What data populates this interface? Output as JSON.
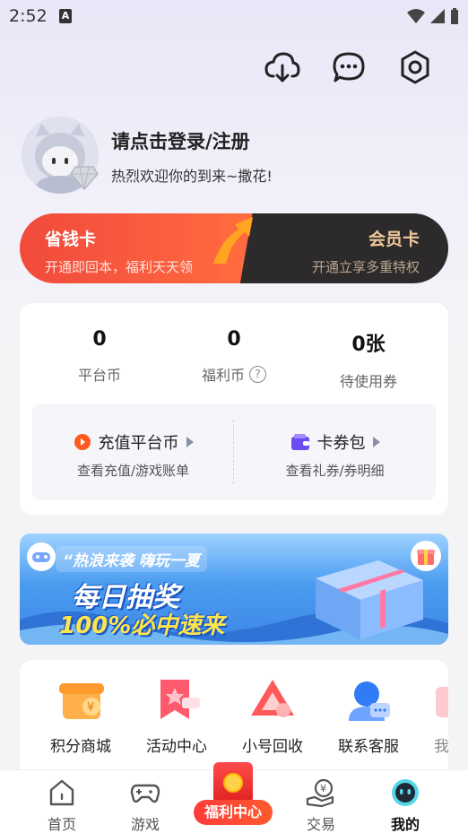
{
  "status_bar": {
    "time": "2:52",
    "indicator": "A"
  },
  "header": {
    "icons": [
      "download-cloud-icon",
      "message-icon",
      "settings-icon"
    ]
  },
  "profile": {
    "login_title": "请点击登录/注册",
    "welcome_text": "热烈欢迎你的到来~撒花!"
  },
  "member_banner": {
    "left_title": "省钱卡",
    "left_sub": "开通即回本，福利天天领",
    "right_title": "会员卡",
    "right_sub": "开通立享多重特权"
  },
  "wallet": {
    "stats": [
      {
        "value": "0",
        "label": "平台币"
      },
      {
        "value": "0",
        "label": "福利币"
      },
      {
        "value": "0张",
        "label": "待使用券"
      }
    ],
    "help_glyph": "?",
    "recharge_title": "充值平台币",
    "recharge_sub": "查看充值/游戏账单",
    "card_title": "卡券包",
    "card_sub": "查看礼券/券明细"
  },
  "promo": {
    "tagline": "“热浪来袭 嗨玩一夏",
    "main": "每日抽奖",
    "sub": "100%必中速来"
  },
  "services": [
    {
      "label": "积分商城",
      "icon": "points-mall-icon"
    },
    {
      "label": "活动中心",
      "icon": "activity-center-icon"
    },
    {
      "label": "小号回收",
      "icon": "account-recycle-icon"
    },
    {
      "label": "联系客服",
      "icon": "customer-service-icon"
    },
    {
      "label": "我",
      "icon": "more-icon"
    }
  ],
  "tabbar": {
    "tabs": [
      {
        "label": "首页"
      },
      {
        "label": "游戏"
      },
      {
        "label": "福利中心"
      },
      {
        "label": "交易"
      },
      {
        "label": "我的"
      }
    ],
    "active_index": 4
  },
  "colors": {
    "accent_red": "#f14a3c",
    "gold": "#f1c89b",
    "dark": "#2c2a2b",
    "promo_blue": "#3e86e6"
  }
}
